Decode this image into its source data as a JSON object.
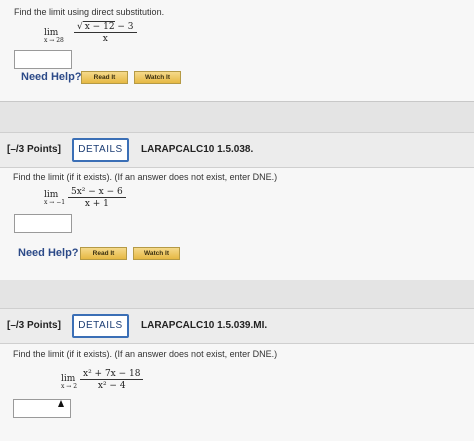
{
  "q1": {
    "prompt": "Find the limit using direct substitution.",
    "lim": "lim",
    "lim_sub": "x → 28",
    "numerator_radicand": "x − 12",
    "numerator_rest": " − 3",
    "denominator": "x",
    "need_help": "Need Help?",
    "read_label": "Read It",
    "watch_label": "Watch It"
  },
  "q2": {
    "points": "[–/3 Points]",
    "details_label": "DETAILS",
    "code": "LARAPCALC10 1.5.038.",
    "prompt": "Find the limit (if it exists). (If an answer does not exist, enter DNE.)",
    "lim": "lim",
    "lim_sub": "x → −1",
    "numerator": "5x² − x − 6",
    "denominator": "x + 1",
    "need_help": "Need Help?",
    "read_label": "Read It",
    "watch_label": "Watch It"
  },
  "q3": {
    "points": "[–/3 Points]",
    "details_label": "DETAILS",
    "code": "LARAPCALC10 1.5.039.MI.",
    "prompt": "Find the limit (if it exists). (If an answer does not exist, enter DNE.)",
    "lim": "lim",
    "lim_sub": "x → 2",
    "numerator": "x² + 7x − 18",
    "denominator": "x² − 4"
  }
}
